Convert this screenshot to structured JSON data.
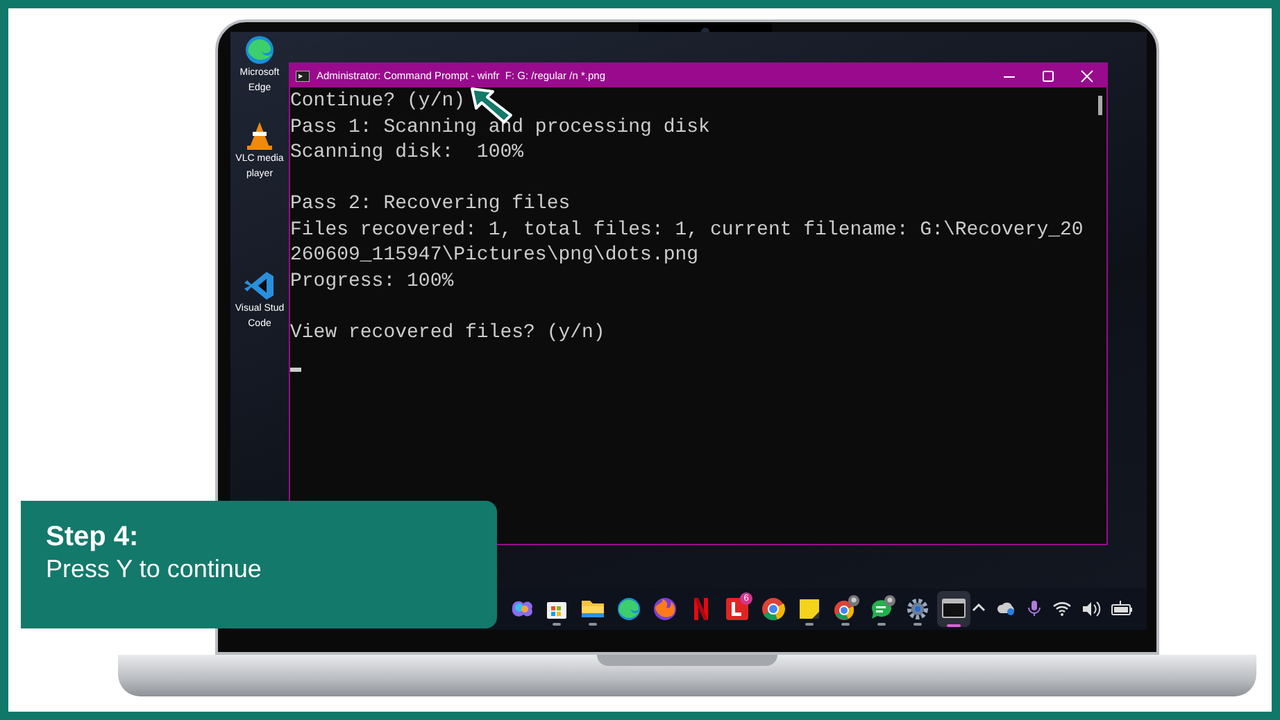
{
  "desktop_icons": [
    {
      "kind": "browser",
      "label_lines": [
        "Microsoft",
        "Edge"
      ]
    },
    {
      "kind": "cone",
      "label_lines": [
        "VLC media",
        "player"
      ]
    },
    {
      "kind": "code-editor",
      "label_lines": [
        "Visual Stud",
        "Code"
      ]
    }
  ],
  "window": {
    "title": "Administrator: Command Prompt - winfr  F: G: /regular /n *.png"
  },
  "console": {
    "blocks": [
      [
        "Continue? (y/n)",
        "Pass 1: Scanning and processing disk",
        "Scanning disk:  100%"
      ],
      [
        "Pass 2: Recovering files",
        "Files recovered: 1, total files: 1, current filename: G:\\Recovery_20",
        "260609_115947\\Pictures\\png\\dots.png",
        "Progress: 100%"
      ],
      [
        "View recovered files? (y/n)"
      ]
    ]
  },
  "taskbar": {
    "apps": [
      {
        "kind": "swirl",
        "running": false,
        "selected": false
      },
      {
        "kind": "bag",
        "running": true,
        "selected": false
      },
      {
        "kind": "folder",
        "running": true,
        "selected": false
      },
      {
        "kind": "wave",
        "running": false,
        "selected": false
      },
      {
        "kind": "flame",
        "running": false,
        "selected": false
      },
      {
        "kind": "ribbon",
        "running": false,
        "selected": false
      },
      {
        "kind": "red-square",
        "running": false,
        "selected": false,
        "badge": "6"
      },
      {
        "kind": "ring",
        "running": false,
        "selected": false
      },
      {
        "kind": "note",
        "running": true,
        "selected": false
      },
      {
        "kind": "ring-avatar",
        "running": true,
        "selected": false
      },
      {
        "kind": "chat",
        "running": true,
        "selected": false
      },
      {
        "kind": "gear",
        "running": true,
        "selected": false
      },
      {
        "kind": "terminal",
        "running": false,
        "selected": true
      }
    ]
  },
  "step": {
    "title": "Step 4:",
    "text": "Press Y to continue"
  }
}
